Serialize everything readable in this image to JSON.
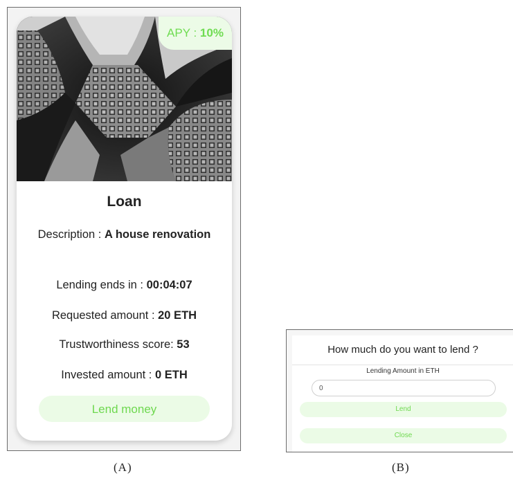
{
  "panel_a": {
    "caption": "(A)",
    "apy_label": "APY : ",
    "apy_value": "10%",
    "title": "Loan",
    "description_label": "Description : ",
    "description_value": "A house renovation",
    "lending_ends_label": "Lending ends in : ",
    "lending_ends_value": "00:04:07",
    "requested_label": "Requested amount : ",
    "requested_value": "20 ETH",
    "trust_label": "Trustworthiness score: ",
    "trust_value": "53",
    "invested_label": "Invested amount : ",
    "invested_value": "0 ETH",
    "lend_button": "Lend money"
  },
  "panel_b": {
    "caption": "(B)",
    "title": "How much do you want to lend ?",
    "field_label": "Lending Amount in ETH",
    "amount_value": "0",
    "lend_button": "Lend",
    "close_button": "Close"
  },
  "colors": {
    "accent_green": "#6ed84f",
    "accent_bg": "#ebfbe6"
  }
}
